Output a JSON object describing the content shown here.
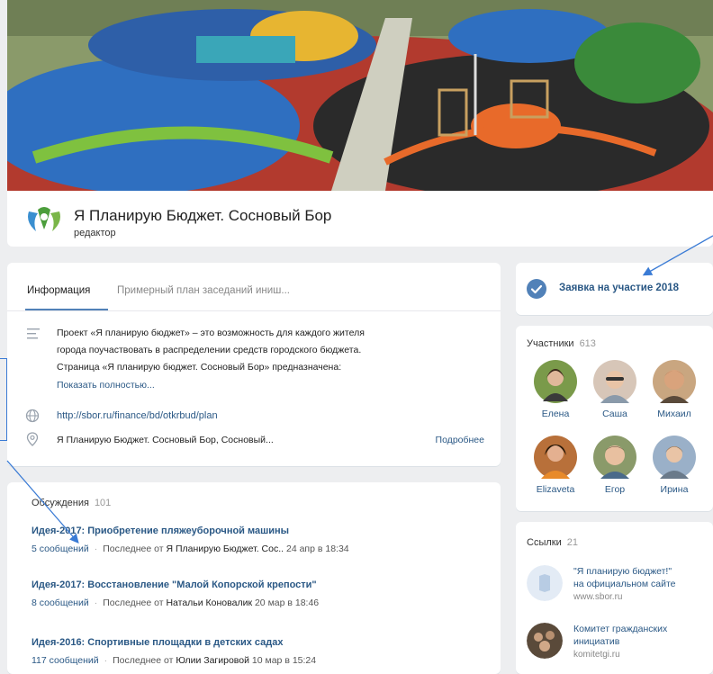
{
  "group": {
    "name": "Я Планирую Бюджет. Сосновый Бор",
    "role": "редактор"
  },
  "tabs": [
    {
      "label": "Информация"
    },
    {
      "label": "Примерный план заседаний иниш..."
    }
  ],
  "info": {
    "description_lines": [
      "Проект «Я планирую бюджет» – это возможность для каждого жителя",
      "города поучаствовать в распределении средств городского бюджета.",
      "Страница «Я планирую бюджет. Сосновый Бор» предназначена:"
    ],
    "show_more": "Показать полностью...",
    "link": "http://sbor.ru/finance/bd/otkrbud/plan",
    "address": "Я Планирую Бюджет. Сосновый Бор, Сосновый...",
    "more": "Подробнее"
  },
  "discussions": {
    "title": "Обсуждения",
    "count": "101",
    "topics": [
      {
        "title": "Идея-2017: Приобретение пляжеуборочной машины",
        "messages": "5 сообщений",
        "last_prefix": "Последнее от",
        "author": "Я Планирую Бюджет. Сос..",
        "date": "24 апр в 18:34"
      },
      {
        "title": "Идея-2017: Восстановление \"Малой Копорской крепости\"",
        "messages": "8 сообщений",
        "last_prefix": "Последнее от",
        "author": "Натальи Коновалик",
        "date": "20 мар в 18:46"
      },
      {
        "title": "Идея-2016: Спортивные площадки в детских садах",
        "messages": "117 сообщений",
        "last_prefix": "Последнее от",
        "author": "Юлии Загировой",
        "date": "10 мар в 15:24"
      }
    ]
  },
  "apply": {
    "label": "Заявка на участие 2018"
  },
  "members": {
    "title": "Участники",
    "count": "613",
    "people": [
      {
        "name": "Елена"
      },
      {
        "name": "Саша"
      },
      {
        "name": "Михаил"
      },
      {
        "name": "Elizaveta"
      },
      {
        "name": "Егор"
      },
      {
        "name": "Ирина"
      }
    ]
  },
  "links": {
    "title": "Ссылки",
    "count": "21",
    "items": [
      {
        "name_lines": [
          "\"Я планирую бюджет!\"",
          "на официальном сайте"
        ],
        "url": "www.sbor.ru"
      },
      {
        "name_lines": [
          "Комитет гражданских",
          "инициатив"
        ],
        "url": "komitetgi.ru"
      }
    ]
  },
  "colors": {
    "accent": "#2a5885",
    "annotation": "#3a7bd5",
    "page_bg": "#edeef0"
  }
}
